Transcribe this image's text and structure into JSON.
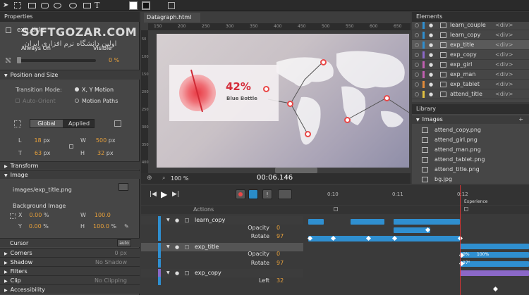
{
  "watermark": {
    "line1": "SOFTGOZAR.COM",
    "line2": "اولین دانشگاه نرم افزاری ایران"
  },
  "properties": {
    "tab": "Properties",
    "element_id": "exp_title",
    "always_on_label": "Always On",
    "visible_label": "Visible",
    "opacity_value": "0 %",
    "position_size_header": "Position and Size",
    "transition_mode_label": "Transition Mode:",
    "xy_motion_label": "X, Y Motion",
    "auto_orient_label": "Auto-Orient",
    "motion_paths_label": "Motion Paths",
    "global_label": "Global",
    "applied_label": "Applied",
    "l_label": "L",
    "l_value": "18",
    "t_label": "T",
    "t_value": "63",
    "w_label": "W",
    "w_value": "500",
    "h_label": "H",
    "h_value": "32",
    "unit_px": "px",
    "transform_header": "Transform",
    "image_header": "Image",
    "image_path": "images/exp_title.png",
    "background_image_label": "Background Image",
    "bg_x_label": "X",
    "bg_x_value": "0.00",
    "bg_y_label": "Y",
    "bg_y_value": "0.00",
    "bg_w_label": "W",
    "bg_w_value": "100.0",
    "bg_h_label": "H",
    "bg_h_value": "100.0",
    "unit_pct": "%",
    "cursor_label": "Cursor",
    "cursor_value": "auto",
    "corners_label": "Corners",
    "corners_value": "0 px",
    "shadow_label": "Shadow",
    "shadow_value": "No Shadow",
    "filters_label": "Filters",
    "clip_label": "Clip",
    "clip_value": "No Clipping",
    "accessibility_label": "Accessibility"
  },
  "stage": {
    "tab": "Datagraph.html",
    "ruler_ticks": [
      "150",
      "200",
      "250",
      "300",
      "350",
      "400",
      "450",
      "500",
      "550",
      "600",
      "650"
    ],
    "ruler_v_ticks": [
      "50",
      "100",
      "150",
      "200",
      "250",
      "300",
      "350",
      "400"
    ],
    "stat_value": "42%",
    "stat_label": "Blue Bottle",
    "zoom": "100 %",
    "timecode": "00:06.146"
  },
  "elements": {
    "tab": "Elements",
    "items": [
      {
        "name": "learn_couple",
        "tag": "<div>",
        "color": "#2f8fd0"
      },
      {
        "name": "learn_copy",
        "tag": "<div>",
        "color": "#2f8fd0"
      },
      {
        "name": "exp_title",
        "tag": "<div>",
        "color": "#2f8fd0"
      },
      {
        "name": "exp_copy",
        "tag": "<div>",
        "color": "#8b68c8"
      },
      {
        "name": "exp_girl",
        "tag": "<div>",
        "color": "#c05fb0"
      },
      {
        "name": "exp_man",
        "tag": "<div>",
        "color": "#c05fb0"
      },
      {
        "name": "exp_tablet",
        "tag": "<div>",
        "color": "#e08a3a"
      },
      {
        "name": "attend_title",
        "tag": "<div>",
        "color": "#e0c040"
      }
    ]
  },
  "library": {
    "tab": "Library",
    "section": "Images",
    "items": [
      "attend_copy.png",
      "attend_girl.png",
      "attend_man.png",
      "attend_tablet.png",
      "attend_title.png",
      "bg.jpg"
    ]
  },
  "timeline": {
    "actions_label": "Actions",
    "ticks": [
      "0:10",
      "0:11",
      "0:12"
    ],
    "experience_label": "Experience",
    "rows": [
      {
        "type": "element",
        "name": "learn_copy"
      },
      {
        "type": "prop",
        "name": "Opacity",
        "value": "0"
      },
      {
        "type": "prop",
        "name": "Rotate",
        "value": "97"
      },
      {
        "type": "element",
        "name": "exp_title"
      },
      {
        "type": "prop",
        "name": "Opacity",
        "value": "0"
      },
      {
        "type": "prop",
        "name": "Rotate",
        "value": "97"
      },
      {
        "type": "element",
        "name": "exp_copy"
      },
      {
        "type": "prop",
        "name": "Left",
        "value": "32"
      }
    ],
    "bar_label_0": "0%",
    "bar_label_100": "100%",
    "bar_label_97": "97°"
  }
}
